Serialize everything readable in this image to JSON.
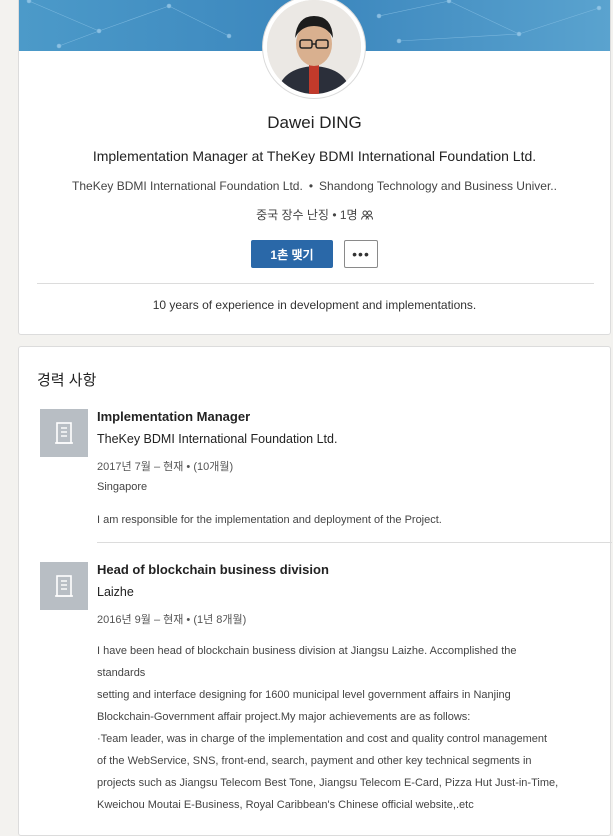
{
  "profile": {
    "name": "Dawei DING",
    "headline": "Implementation Manager at TheKey BDMI International Foundation Ltd.",
    "current_company": "TheKey BDMI International Foundation Ltd.",
    "separator": "•",
    "education": "Shandong Technology and Business Univer..",
    "location": "중국 장수 난징",
    "connections": "• 1명",
    "connect_button": "1촌 맺기",
    "more_button": "•••",
    "summary": "10 years of experience in development and implementations."
  },
  "experience": {
    "section_title": "경력 사항",
    "jobs": [
      {
        "title": "Implementation Manager",
        "company": "TheKey BDMI International Foundation Ltd.",
        "dates": "2017년 7월 – 현재  • (10개월)",
        "location": "Singapore",
        "description": [
          "I am responsible for the implementation and deployment of the Project."
        ]
      },
      {
        "title": "Head of blockchain business division",
        "company": "Laizhe",
        "dates": "2016년 9월 – 현재  • (1년 8개월)",
        "description": [
          "I have been head of blockchain business division at Jiangsu Laizhe. Accomplished the standards",
          "setting and interface designing for 1600 municipal level government affairs in Nanjing",
          "Blockchain-Government affair project.My major achievements are as follows:",
          "·Team leader, was in charge of the implementation and cost and quality control management",
          "of the WebService, SNS, front-end, search, payment and other key technical segments in",
          "projects such as Jiangsu Telecom Best Tone, Jiangsu Telecom E-Card, Pizza Hut Just-in-Time,",
          "Kweichou Moutai E-Business, Royal Caribbean's Chinese official website,.etc"
        ]
      }
    ]
  },
  "icons": {
    "company_logo": "building-icon",
    "connections": "people-icon",
    "more": "ellipsis-icon"
  },
  "colors": {
    "primary_button": "#2a68a8",
    "banner": "#3b86bd",
    "logo_placeholder": "#b8bec4"
  }
}
